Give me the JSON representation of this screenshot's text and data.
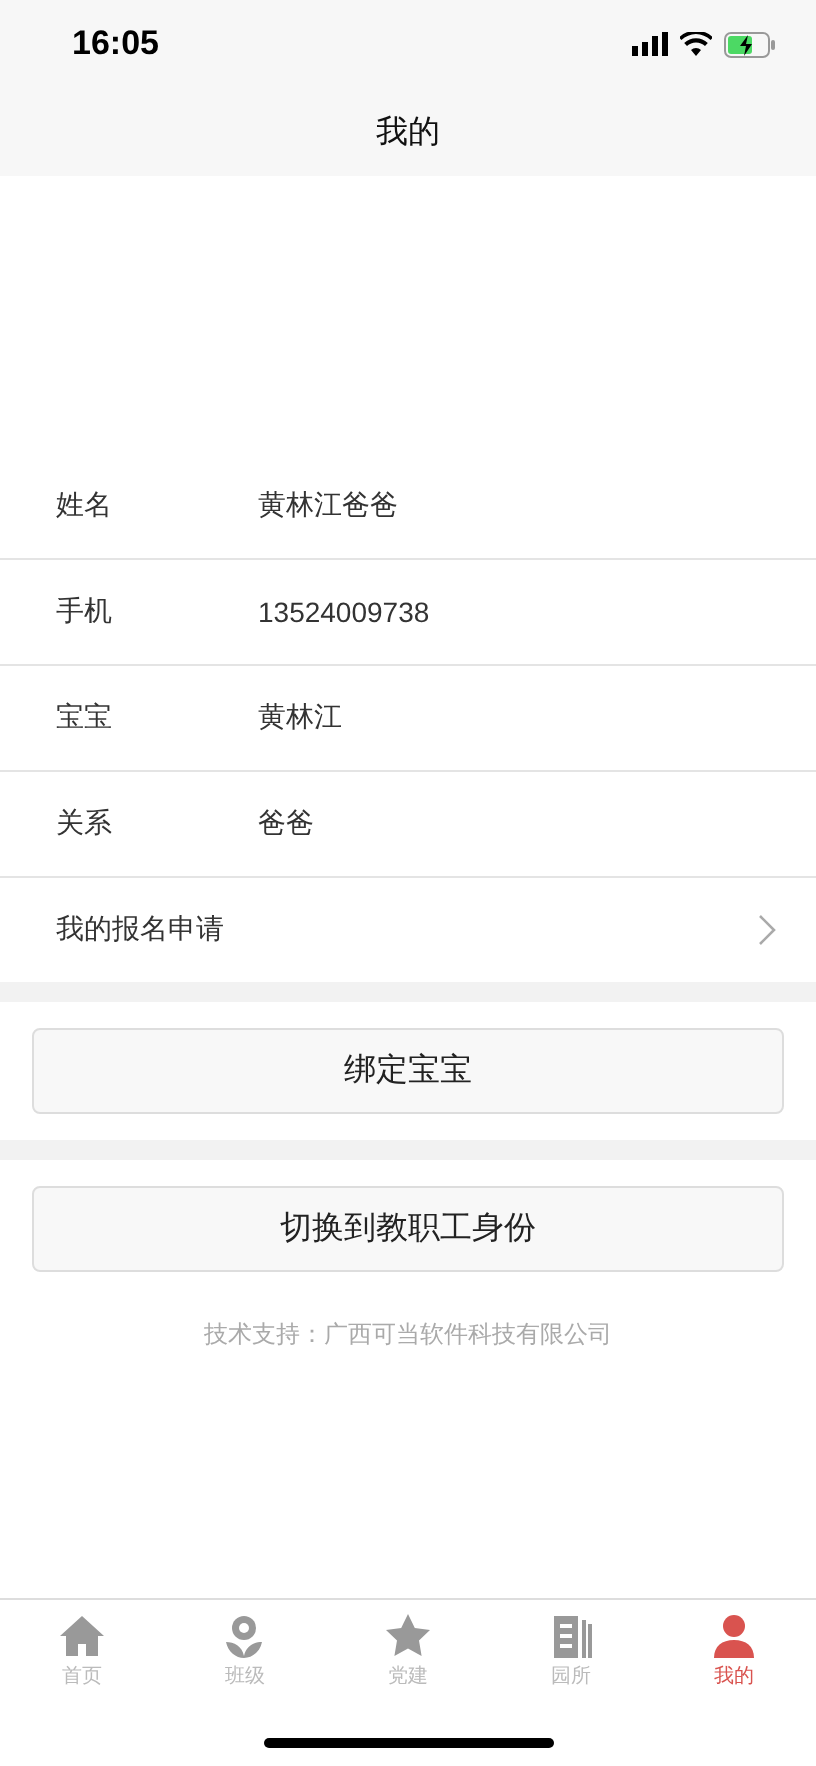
{
  "status_bar": {
    "time": "16:05"
  },
  "nav": {
    "title": "我的"
  },
  "profile": [
    {
      "label": "姓名",
      "value": "黄林江爸爸"
    },
    {
      "label": "手机",
      "value": "13524009738"
    },
    {
      "label": "宝宝",
      "value": "黄林江"
    },
    {
      "label": "关系",
      "value": "爸爸"
    }
  ],
  "link_row": {
    "label": "我的报名申请"
  },
  "buttons": [
    "绑定宝宝",
    "切换到教职工身份"
  ],
  "footer": "技术支持：广西可当软件科技有限公司",
  "tabs": [
    {
      "label": "首页",
      "kind": "house",
      "selected": false
    },
    {
      "label": "班级",
      "kind": "flower",
      "selected": false
    },
    {
      "label": "党建",
      "kind": "star",
      "selected": false
    },
    {
      "label": "园所",
      "kind": "building",
      "selected": false
    },
    {
      "label": "我的",
      "kind": "person",
      "selected": true
    }
  ]
}
